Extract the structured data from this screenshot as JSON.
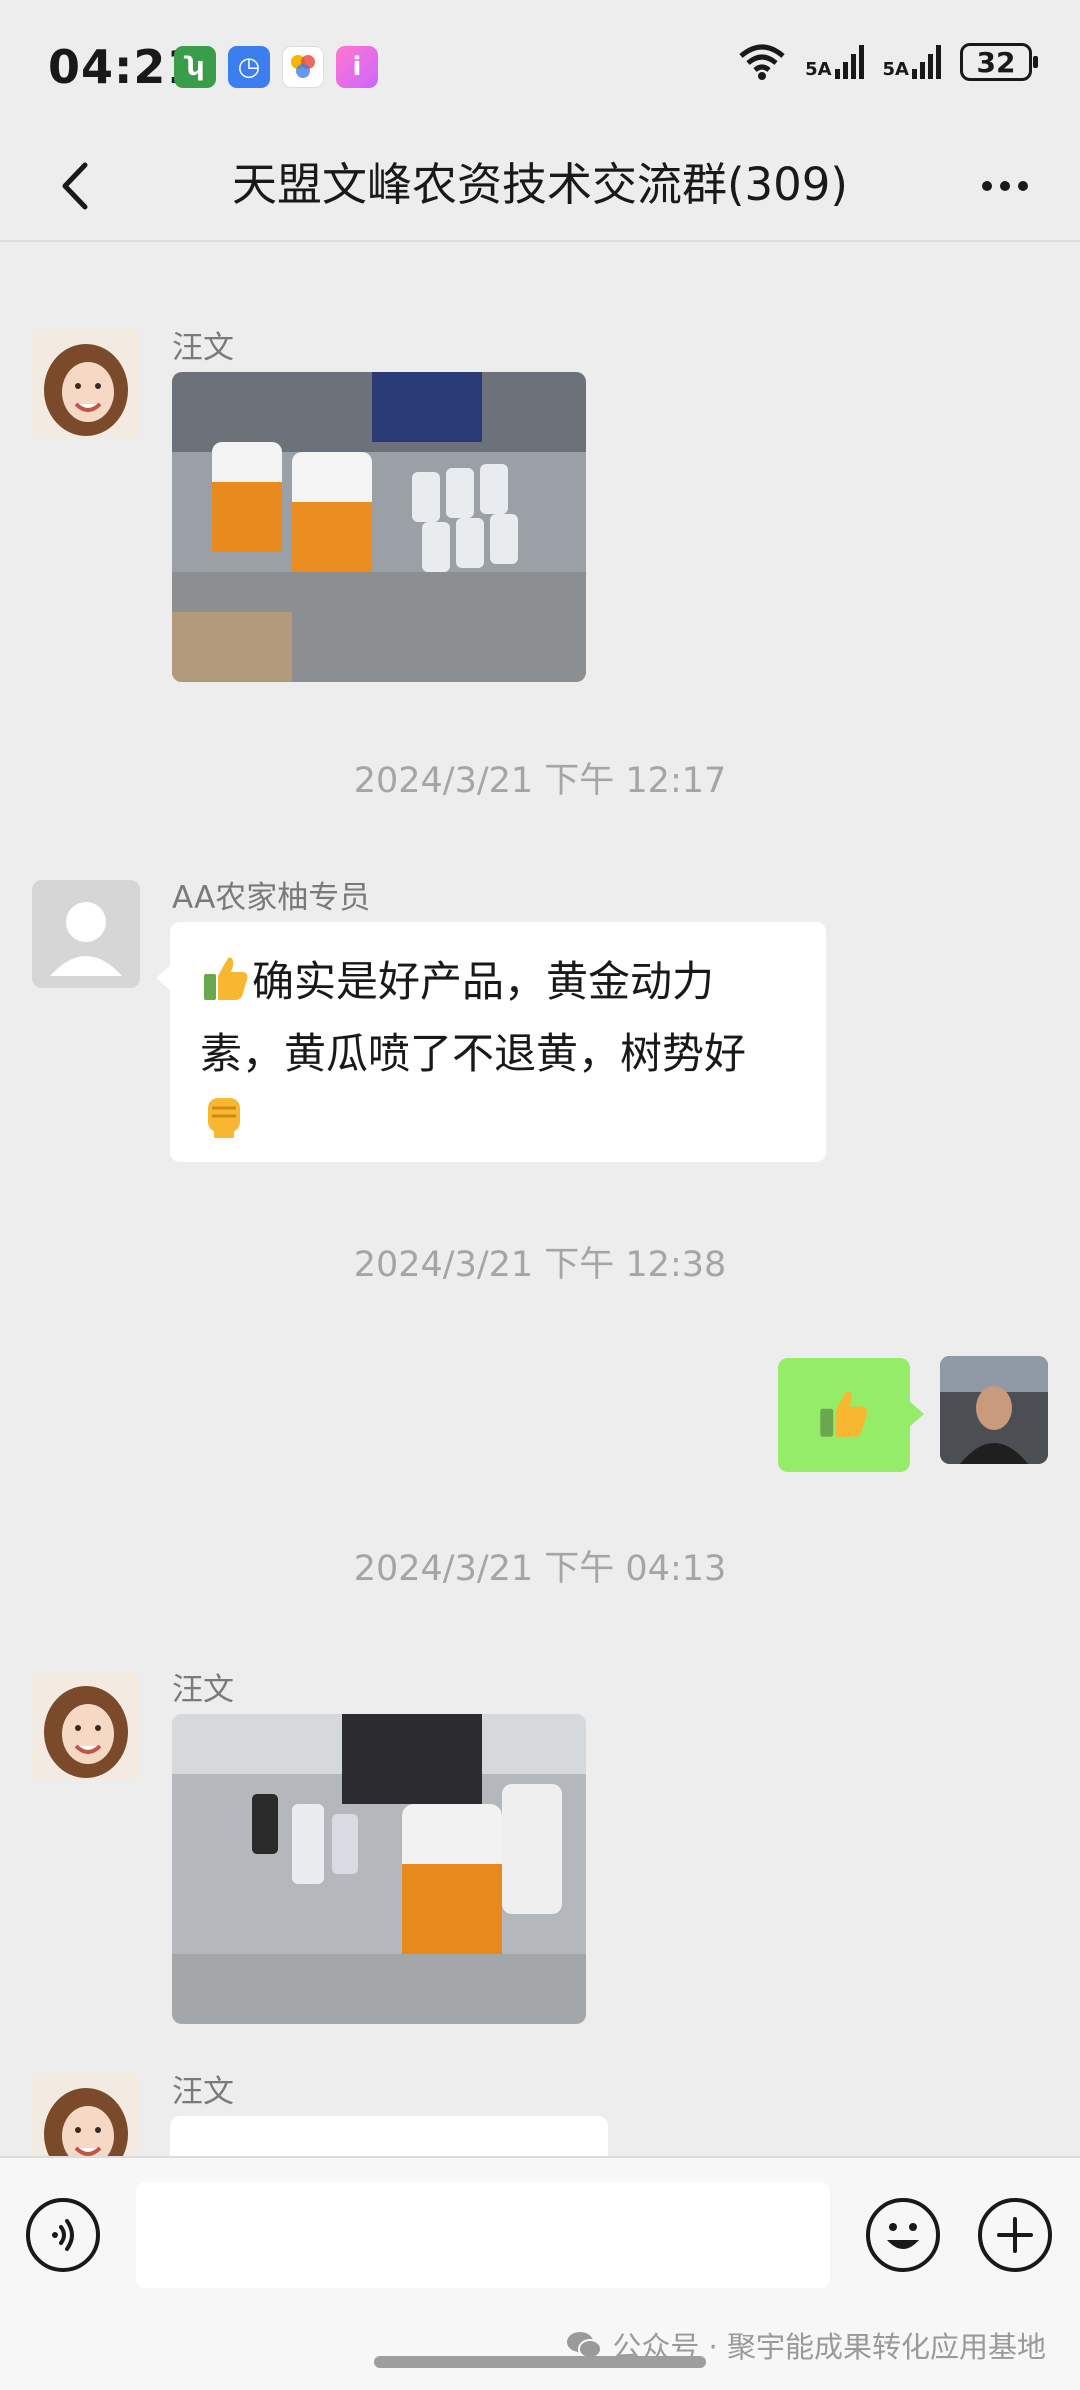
{
  "status_bar": {
    "time": "04:21",
    "network_1": "5A",
    "network_2": "5A",
    "battery": "32"
  },
  "header": {
    "title": "天盟文峰农资技术交流群(309)"
  },
  "messages": [
    {
      "type": "image",
      "sender": "汪文"
    },
    {
      "type": "timestamp",
      "text": "2024/3/21 下午 12:17"
    },
    {
      "type": "text",
      "sender": "AA农家柚专员",
      "line1": "确实是好产品，黄金动力",
      "line2": "素，黄瓜喷了不退黄，树势好"
    },
    {
      "type": "timestamp",
      "text": "2024/3/21 下午 12:38"
    },
    {
      "type": "outgoing-emoji"
    },
    {
      "type": "timestamp",
      "text": "2024/3/21 下午 04:13"
    },
    {
      "type": "image",
      "sender": "汪文"
    },
    {
      "type": "text",
      "sender": "汪文"
    }
  ],
  "footer": {
    "watermark": "公众号 · 聚宇能成果转化应用基地"
  },
  "colors": {
    "background": "#ededed",
    "incoming_bubble": "#ffffff",
    "outgoing_bubble": "#95ec69"
  }
}
